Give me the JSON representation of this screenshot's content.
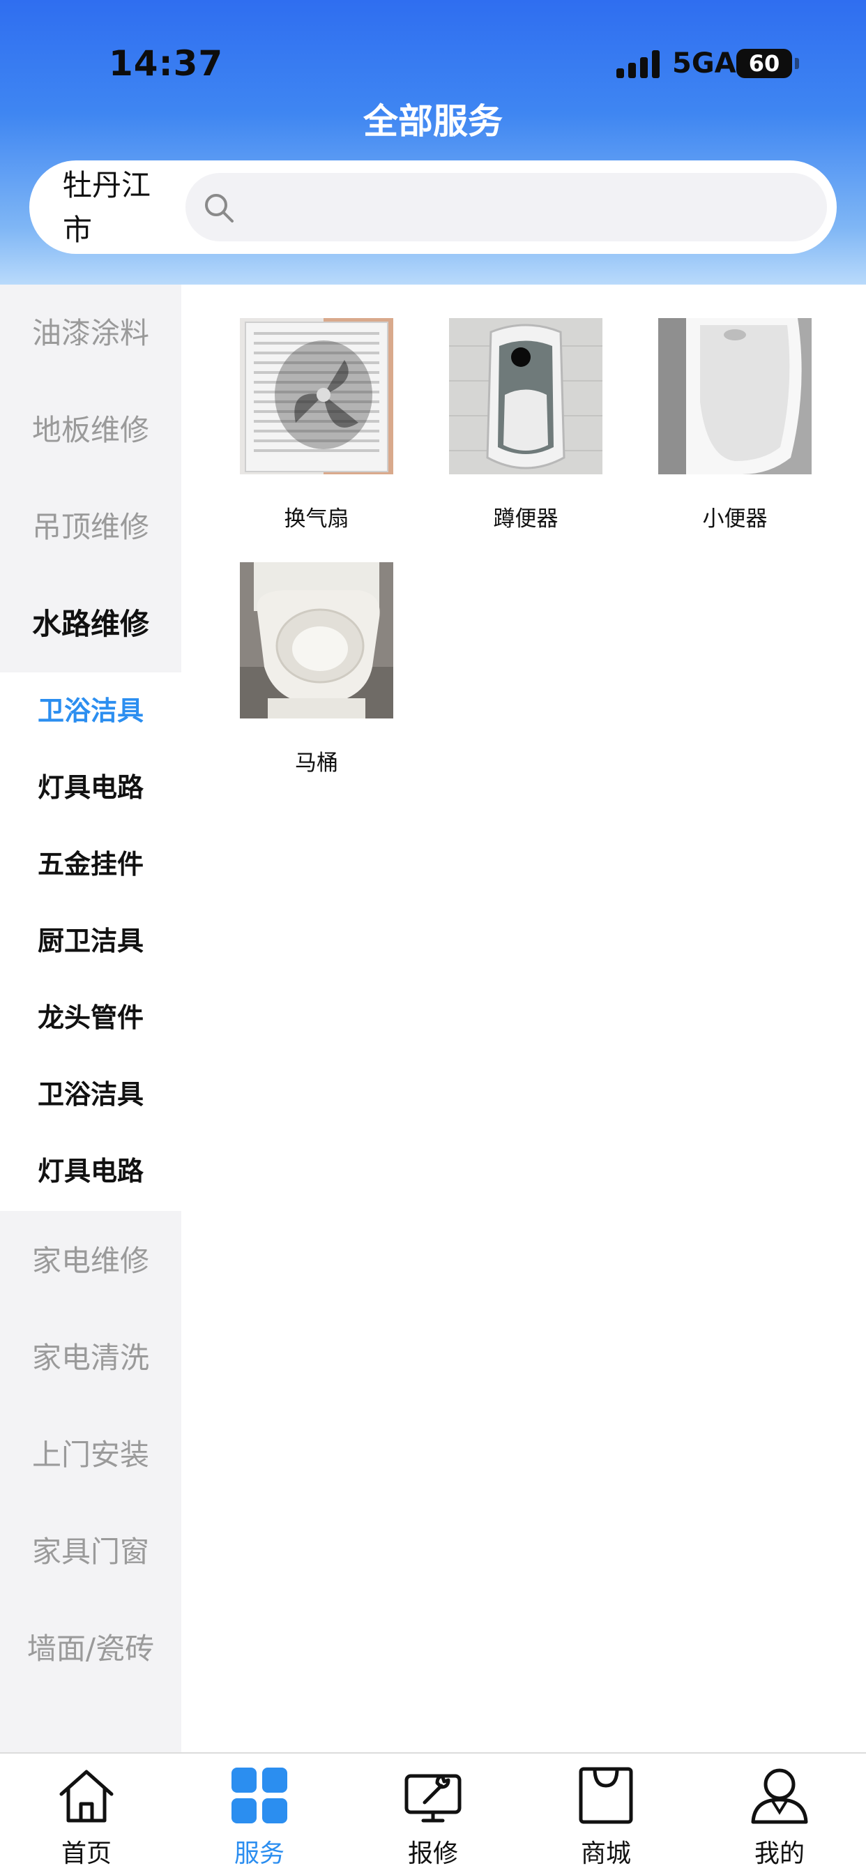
{
  "status_bar": {
    "time": "14:37",
    "network": "5GA",
    "battery": "60"
  },
  "header": {
    "title": "全部服务"
  },
  "search": {
    "city": "牡丹江市",
    "placeholder": ""
  },
  "sidebar": {
    "items_top": [
      {
        "label": "油漆涂料",
        "active": false
      },
      {
        "label": "地板维修",
        "active": false
      },
      {
        "label": "吊顶维修",
        "active": false
      },
      {
        "label": "水路维修",
        "active": true
      }
    ],
    "sub_items": [
      {
        "label": "卫浴洁具",
        "active": true
      },
      {
        "label": "灯具电路",
        "active": false
      },
      {
        "label": "五金挂件",
        "active": false
      },
      {
        "label": "厨卫洁具",
        "active": false
      },
      {
        "label": "龙头管件",
        "active": false
      },
      {
        "label": "卫浴洁具",
        "active": false
      },
      {
        "label": "灯具电路",
        "active": false
      }
    ],
    "items_bottom": [
      {
        "label": "家电维修",
        "active": false
      },
      {
        "label": "家电清洗",
        "active": false
      },
      {
        "label": "上门安装",
        "active": false
      },
      {
        "label": "家具门窗",
        "active": false
      },
      {
        "label": "墙面/瓷砖",
        "active": false
      }
    ]
  },
  "products": [
    {
      "name": "换气扇",
      "icon": "exhaust-fan-image"
    },
    {
      "name": "蹲便器",
      "icon": "squat-toilet-image"
    },
    {
      "name": "小便器",
      "icon": "urinal-image"
    },
    {
      "name": "马桶",
      "icon": "toilet-image"
    }
  ],
  "tabbar": {
    "tabs": [
      {
        "label": "首页",
        "icon": "home-icon",
        "active": false
      },
      {
        "label": "服务",
        "icon": "grid-icon",
        "active": true
      },
      {
        "label": "报修",
        "icon": "repair-monitor-icon",
        "active": false
      },
      {
        "label": "商城",
        "icon": "shopping-bag-icon",
        "active": false
      },
      {
        "label": "我的",
        "icon": "user-icon",
        "active": false
      }
    ]
  },
  "colors": {
    "accent": "#2b8ef0",
    "header_top": "#2f6ef0",
    "sidebar_bg": "#f3f3f5",
    "muted_text": "#9a9a9a"
  }
}
